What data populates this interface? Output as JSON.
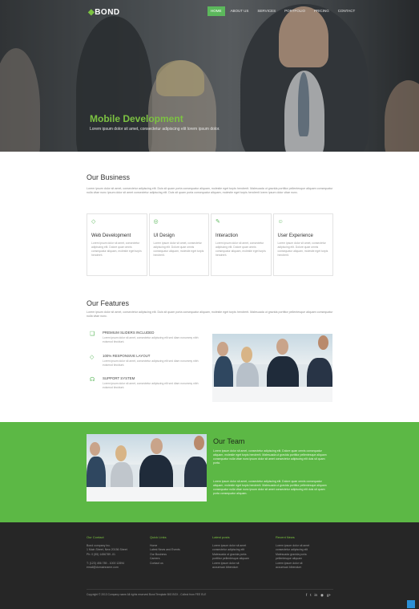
{
  "header": {
    "logo_text": "BOND",
    "nav": [
      "HOME",
      "ABOUT US",
      "SERVICES",
      "PORTFOLIO",
      "PRICING",
      "CONTACT"
    ]
  },
  "hero": {
    "title": "Mobile Development",
    "subtitle": "Lorem ipsum dolor sit amet, consectetur adipiscing elit lorem ipsum dolor."
  },
  "business": {
    "title": "Our Business",
    "paragraph": "Lorem ipsum dolor sit amet, consectetur adipiscing elit. Duis sit quam porta consequatur aliquam, molestie eget turpis hendrerit. Malesuada ut gravida porttitor pellentesque aliquam consequatur nulla vitae nunc ipsum dolor sit amet consectetur adipiscing elit. Duis sit quam porta consequatur aliquam, molestie eget turpis hendrerit lorem ipsum dolor vitae nunc.",
    "cards": [
      {
        "icon": "diamond-icon",
        "glyph": "◇",
        "title": "Web Development",
        "text": "Lorem ipsum dolor sit amet, consectetur adipiscing elit. Dolore quae omnis consequatur aliquam, molestie eget turpis hendrerit."
      },
      {
        "icon": "target-icon",
        "glyph": "◎",
        "title": "UI Design",
        "text": "Lorem ipsum dolor sit amet, consectetur adipiscing elit. Dolore quae omnis consequatur aliquam, molestie eget turpis hendrerit."
      },
      {
        "icon": "edit-icon",
        "glyph": "✎",
        "title": "Interaction",
        "text": "Lorem ipsum dolor sit amet, consectetur adipiscing elit. Dolore quae omnis consequatur aliquam, molestie eget turpis hendrerit."
      },
      {
        "icon": "users-icon",
        "glyph": "☺",
        "title": "User Experience",
        "text": "Lorem ipsum dolor sit amet, consectetur adipiscing elit. Dolore quae omnis consequatur aliquam, molestie eget turpis hendrerit."
      }
    ]
  },
  "features": {
    "title": "Our Features",
    "paragraph": "Lorem ipsum dolor sit amet, consectetur adipiscing elit. Duis sit quam porta consequatur aliquam, molestie eget turpis hendrerit. Malesuada ut gravida porttitor pellentesque aliquam consequatur nulla vitae nunc.",
    "items": [
      {
        "icon": "book-icon",
        "glyph": "❑",
        "title": "PREMIUM SLIDERS INCLUDED",
        "text": "Lorem ipsum dolor sit amet, consectetur adipiscing elit sed diam nonummy nibh euismod tincidunt."
      },
      {
        "icon": "diamond-icon",
        "glyph": "◇",
        "title": "100% RESPONSIVE LAYOUT",
        "text": "Lorem ipsum dolor sit amet, consectetur adipiscing elit sed diam nonummy nibh euismod tincidunt."
      },
      {
        "icon": "headset-icon",
        "glyph": "☊",
        "title": "SUPPORT SYSTEM",
        "text": "Lorem ipsum dolor sit amet, consectetur adipiscing elit sed diam nonummy nibh euismod tincidunt."
      }
    ]
  },
  "team": {
    "title": "Our Team",
    "paragraph1": "Lorem ipsum dolor sit amet, consectetur adipiscing elit. Dolore quae omnis consequatur aliquam, molestie eget turpis hendrerit. Malesuada ut gravida porttitor pellentesque aliquam consequatur nulla vitae nunc ipsum dolor sit amet consectetur adipiscing elit duis sit quam porta.",
    "paragraph2": "Lorem ipsum dolor sit amet, consectetur adipiscing elit. Dolore quae omnis consequatur aliquam, molestie eget turpis hendrerit. Malesuada ut gravida porttitor pellentesque aliquam consequatur nulla vitae nunc ipsum dolor sit amet consectetur adipiscing elit duis sit quam porta consequatur aliquam."
  },
  "footer": {
    "columns": [
      {
        "heading": "Our Contact",
        "lines": [
          "Bond company Inc.",
          "1 Main Street, New 20156 Street",
          "Ph: 0 (55) 1456789 -01",
          "",
          "T: (123) 456 789 - 1000 12894",
          "email@domainname.com"
        ]
      },
      {
        "heading": "Quick Links",
        "lines": [
          "Home",
          "Latest News and Events",
          "Our Business",
          "Careers",
          "Contact us"
        ]
      },
      {
        "heading": "Latest posts",
        "lines": [
          "Lorem ipsum dolor sit amet",
          "consectetur adipiscing elit",
          "Malesuada ut gravida porta",
          "porttitor pellentesque aliquam",
          "Lorem ipsum dolor sit",
          "accumsan bibendum"
        ]
      },
      {
        "heading": "Recent News",
        "lines": [
          "Lorem ipsum dolor sit amet",
          "consectetur adipiscing elit",
          "Malesuada gravida porta",
          "pellentesque aliquam",
          "Lorem ipsum dolor sit",
          "accumsan bibendum"
        ]
      }
    ],
    "copyright": "Copyright © 2013 Company name All rights reserved Bond Template BIG BOX - Collect from FEE ELE",
    "socials": [
      "facebook-icon",
      "twitter-icon",
      "linkedin-icon",
      "rss-icon",
      "google-plus-icon"
    ],
    "social_glyphs": [
      "f",
      "t",
      "in",
      "◉",
      "g+"
    ]
  },
  "colors": {
    "accent": "#5cb845",
    "footer_bg": "#262626",
    "to_top": "#2a8fd6"
  }
}
